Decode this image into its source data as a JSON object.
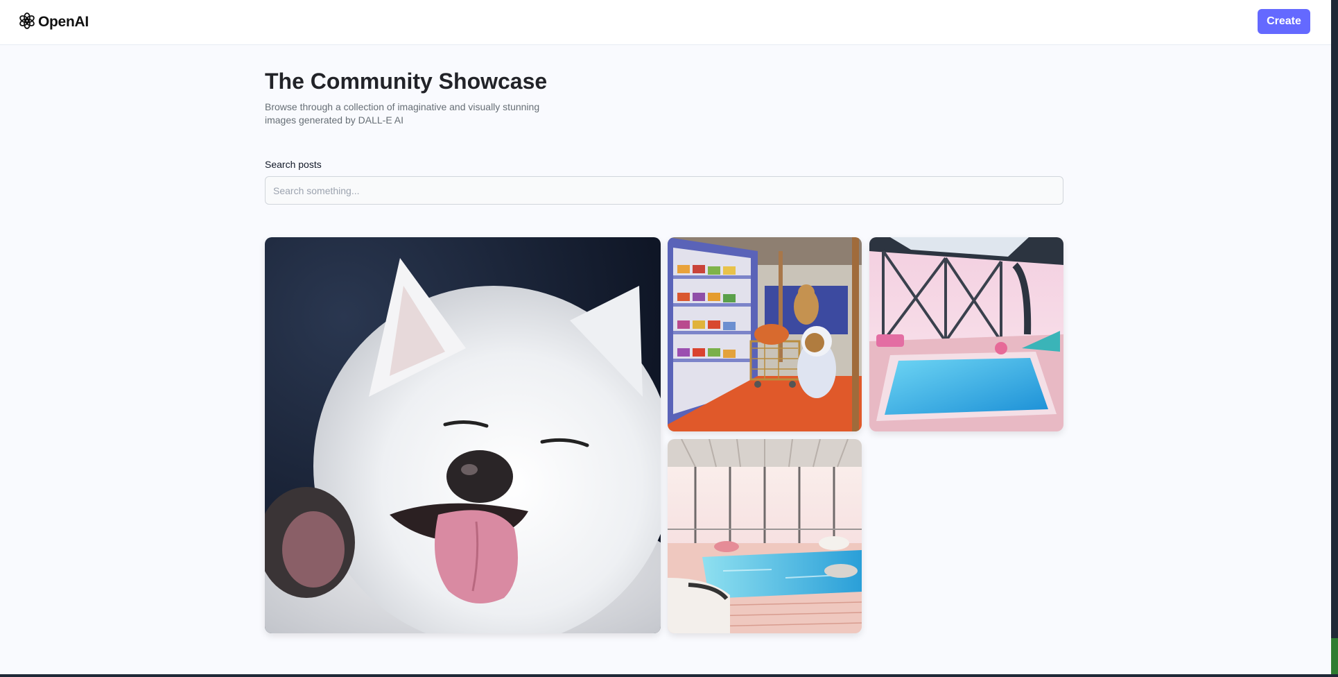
{
  "header": {
    "brand": "OpenAI",
    "logo_icon": "openai-logo-icon",
    "create_label": "Create",
    "accent_color": "#6469ff"
  },
  "page": {
    "title": "The Community Showcase",
    "subtitle": "Browse through a collection of imaginative and visually stunning images generated by DALL-E AI"
  },
  "search": {
    "label": "Search posts",
    "placeholder": "Search something...",
    "value": ""
  },
  "gallery": {
    "items": [
      {
        "subject": "fluffy white dog with tongue out"
      },
      {
        "subject": "teddy bear astronauts shopping in a grocery store"
      },
      {
        "subject": "pink interior with indoor swimming pool and glass roof"
      },
      {
        "subject": "penthouse lounge with infinity pool at sunset"
      }
    ]
  }
}
